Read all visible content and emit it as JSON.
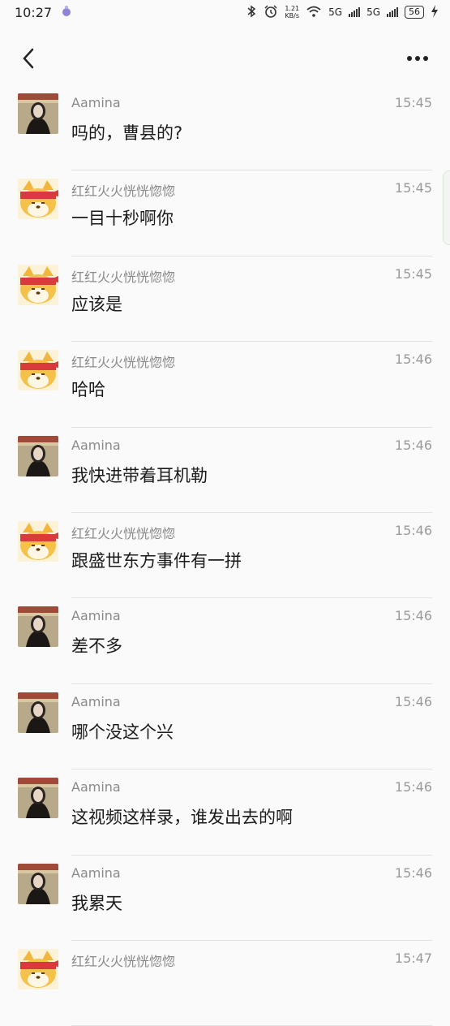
{
  "status_bar": {
    "time": "10:27",
    "net_speed_value": "1.21",
    "net_speed_unit": "KB/s",
    "network_1": "5G",
    "network_2": "5G",
    "battery": "56"
  },
  "messages": [
    {
      "sender": "Aamina",
      "time": "15:45",
      "text": "吗的，曹县的?",
      "avatar": "woman-avatar"
    },
    {
      "sender": "红红火火恍恍惚惚",
      "time": "15:45",
      "text": "一目十秒啊你",
      "avatar": "dog-avatar"
    },
    {
      "sender": "红红火火恍恍惚惚",
      "time": "15:45",
      "text": "应该是",
      "avatar": "dog-avatar"
    },
    {
      "sender": "红红火火恍恍惚惚",
      "time": "15:46",
      "text": "哈哈",
      "avatar": "dog-avatar"
    },
    {
      "sender": "Aamina",
      "time": "15:46",
      "text": "我快进带着耳机勒",
      "avatar": "woman-avatar"
    },
    {
      "sender": "红红火火恍恍惚惚",
      "time": "15:46",
      "text": "跟盛世东方事件有一拼",
      "avatar": "dog-avatar"
    },
    {
      "sender": "Aamina",
      "time": "15:46",
      "text": "差不多",
      "avatar": "woman-avatar"
    },
    {
      "sender": "Aamina",
      "time": "15:46",
      "text": "哪个没这个兴",
      "avatar": "woman-avatar"
    },
    {
      "sender": "Aamina",
      "time": "15:46",
      "text": "这视频这样录，谁发出去的啊",
      "avatar": "woman-avatar"
    },
    {
      "sender": "Aamina",
      "time": "15:46",
      "text": "我累天",
      "avatar": "woman-avatar"
    },
    {
      "sender": "红红火火恍恍惚惚",
      "time": "15:47",
      "text": "",
      "avatar": "dog-avatar"
    }
  ]
}
